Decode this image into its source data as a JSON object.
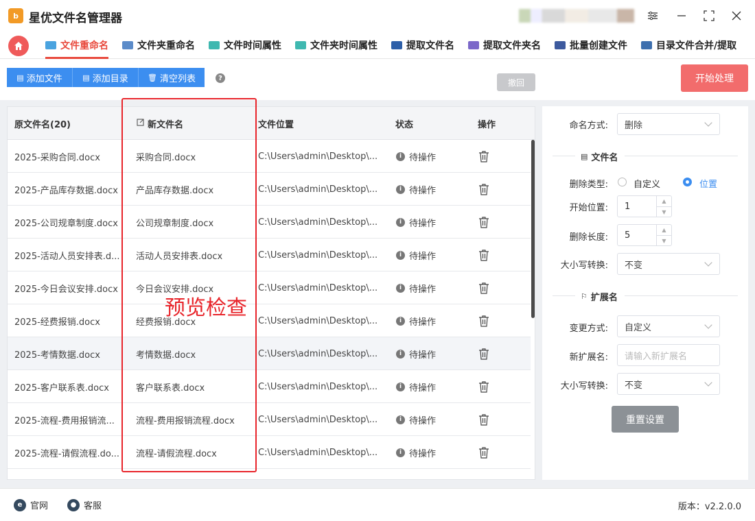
{
  "app": {
    "logo_text": "b",
    "title": "星优文件名管理器"
  },
  "tabs": [
    {
      "label": "文件重命名",
      "active": true,
      "icon": "file-rename-icon"
    },
    {
      "label": "文件夹重命名",
      "icon": "folder-rename-icon"
    },
    {
      "label": "文件时间属性",
      "icon": "file-time-icon"
    },
    {
      "label": "文件夹时间属性",
      "icon": "folder-time-icon"
    },
    {
      "label": "提取文件名",
      "icon": "extract-filename-icon"
    },
    {
      "label": "提取文件夹名",
      "icon": "extract-foldername-icon"
    },
    {
      "label": "批量创建文件",
      "icon": "batch-create-icon"
    },
    {
      "label": "目录文件合并/提取",
      "icon": "merge-extract-icon"
    }
  ],
  "toolbar": {
    "add_file": "添加文件",
    "add_dir": "添加目录",
    "clear_list": "清空列表",
    "help": "?",
    "undo": "撤回",
    "start": "开始处理"
  },
  "table": {
    "headers": {
      "original": "原文件名(20)",
      "new_name": "新文件名",
      "location": "文件位置",
      "status": "状态",
      "action": "操作"
    },
    "rows": [
      {
        "original": "2025-采购合同.docx",
        "new_name": "采购合同.docx",
        "location": "C:\\Users\\admin\\Desktop\\...",
        "status": "待操作"
      },
      {
        "original": "2025-产品库存数据.docx",
        "new_name": "产品库存数据.docx",
        "location": "C:\\Users\\admin\\Desktop\\...",
        "status": "待操作"
      },
      {
        "original": "2025-公司规章制度.docx",
        "new_name": "公司规章制度.docx",
        "location": "C:\\Users\\admin\\Desktop\\...",
        "status": "待操作"
      },
      {
        "original": "2025-活动人员安排表.d...",
        "new_name": "活动人员安排表.docx",
        "location": "C:\\Users\\admin\\Desktop\\...",
        "status": "待操作"
      },
      {
        "original": "2025-今日会议安排.docx",
        "new_name": "今日会议安排.docx",
        "location": "C:\\Users\\admin\\Desktop\\...",
        "status": "待操作"
      },
      {
        "original": "2025-经费报销.docx",
        "new_name": "经费报销.docx",
        "location": "C:\\Users\\admin\\Desktop\\...",
        "status": "待操作"
      },
      {
        "original": "2025-考情数据.docx",
        "new_name": "考情数据.docx",
        "location": "C:\\Users\\admin\\Desktop\\...",
        "status": "待操作"
      },
      {
        "original": "2025-客户联系表.docx",
        "new_name": "客户联系表.docx",
        "location": "C:\\Users\\admin\\Desktop\\...",
        "status": "待操作"
      },
      {
        "original": "2025-流程-费用报销流...",
        "new_name": "流程-费用报销流程.docx",
        "location": "C:\\Users\\admin\\Desktop\\...",
        "status": "待操作"
      },
      {
        "original": "2025-流程-请假流程.do...",
        "new_name": "流程-请假流程.docx",
        "location": "C:\\Users\\admin\\Desktop\\...",
        "status": "待操作"
      }
    ]
  },
  "overlay": {
    "text": "预览检查"
  },
  "settings": {
    "naming_label": "命名方式:",
    "naming_value": "删除",
    "filename_section": "文件名",
    "delete_type_label": "删除类型:",
    "delete_type_custom": "自定义",
    "delete_type_position": "位置",
    "start_pos_label": "开始位置:",
    "start_pos_value": "1",
    "delete_len_label": "删除长度:",
    "delete_len_value": "5",
    "case_label": "大小写转换:",
    "case_value": "不变",
    "ext_section": "扩展名",
    "change_mode_label": "变更方式:",
    "change_mode_value": "自定义",
    "new_ext_label": "新扩展名:",
    "new_ext_placeholder": "请输入新扩展名",
    "ext_case_label": "大小写转换:",
    "ext_case_value": "不变",
    "reset": "重置设置"
  },
  "footer": {
    "website": "官网",
    "service": "客服",
    "version": "版本：v2.2.0.0"
  },
  "colors": {
    "accent_red": "#e8483b",
    "primary_blue": "#3c8ef0",
    "start_button": "#f26c6c",
    "highlight_box": "#e8242a"
  }
}
